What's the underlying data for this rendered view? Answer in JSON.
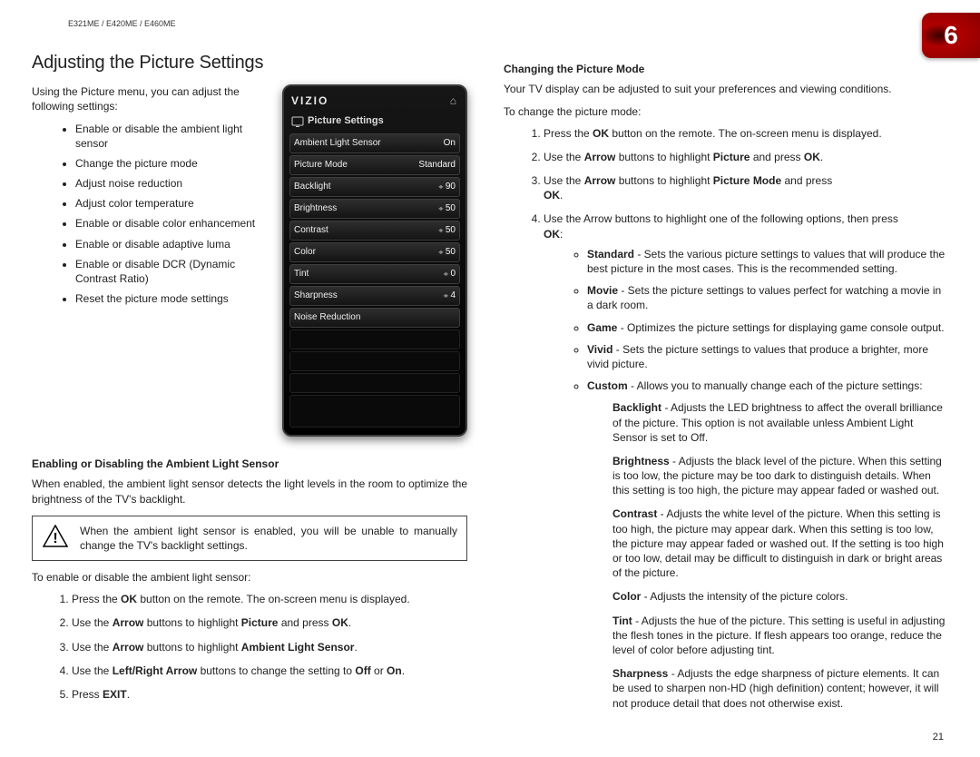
{
  "header": {
    "model": "E321ME / E420ME / E460ME",
    "chapter": "6"
  },
  "page_number": "21",
  "left": {
    "title": "Adjusting the Picture Settings",
    "intro": "Using the Picture menu, you can adjust the following settings:",
    "bullets": [
      "Enable or disable the ambient light sensor",
      "Change the picture mode",
      "Adjust noise reduction",
      "Adjust color temperature",
      "Enable or disable color enhancement",
      "Enable or disable adaptive luma",
      "Enable or disable DCR (Dynamic Contrast Ratio)",
      "Reset the picture mode settings"
    ],
    "subhead1": "Enabling or Disabling the Ambient Light Sensor",
    "als_para": "When enabled, the ambient light sensor detects the light levels in the room to optimize the brightness of the TV's backlight.",
    "warning": "When the ambient light sensor is enabled, you will be unable to manually change the TV's backlight settings.",
    "als_lead": "To enable or disable the ambient light sensor:",
    "steps1": {
      "s1a": "Press the ",
      "s1b": "OK",
      "s1c": " button on the remote. The on-screen menu is displayed.",
      "s2a": "Use the ",
      "s2b": "Arrow",
      "s2c": " buttons to highlight ",
      "s2d": "Picture",
      "s2e": " and press ",
      "s2f": "OK",
      "s2g": ".",
      "s3a": "Use the ",
      "s3b": "Arrow",
      "s3c": " buttons to highlight ",
      "s3d": "Ambient Light Sensor",
      "s3e": ".",
      "s4a": "Use the ",
      "s4b": "Left/Right Arrow",
      "s4c": " buttons to change the setting to ",
      "s4d": "Off",
      "s4e": " or ",
      "s4f": "On",
      "s4g": ".",
      "s5a": "Press ",
      "s5b": "EXIT",
      "s5c": "."
    }
  },
  "right": {
    "subhead": "Changing the Picture Mode",
    "intro": "Your TV display can be adjusted to suit your preferences and viewing conditions.",
    "lead": "To change the picture mode:",
    "steps": {
      "s1a": "Press the ",
      "s1b": "OK",
      "s1c": " button on the remote. The on-screen menu is displayed.",
      "s2a": "Use the ",
      "s2b": "Arrow",
      "s2c": " buttons to highlight ",
      "s2d": "Picture",
      "s2e": " and press ",
      "s2f": "OK",
      "s2g": ".",
      "s3a": "Use the ",
      "s3b": "Arrow",
      "s3c": " buttons to highlight ",
      "s3d": "Picture Mode",
      "s3e": " and press ",
      "s3f": "OK",
      "s3g": ".",
      "s4a": "Use the Arrow buttons to highlight one of the following options, then press ",
      "s4b": "OK",
      "s4c": ":"
    },
    "options": {
      "standard_b": "Standard",
      "standard_t": " - Sets the various picture settings to values that will produce the best picture in the most cases. This is the recommended setting.",
      "movie_b": "Movie",
      "movie_t": " - Sets the picture settings to values perfect for watching a movie in a dark room.",
      "game_b": "Game",
      "game_t": " - Optimizes the picture settings for displaying game console output.",
      "vivid_b": "Vivid",
      "vivid_t": " - Sets the picture settings to values that produce a brighter, more vivid picture.",
      "custom_b": "Custom",
      "custom_t": " - Allows you to manually change each of the picture settings:"
    },
    "custom": {
      "backlight_b": "Backlight",
      "backlight_t": " - Adjusts the LED brightness to affect the overall brilliance of the picture. This option is not available unless Ambient Light Sensor is set to Off.",
      "brightness_b": "Brightness",
      "brightness_t": " - Adjusts the black level of the picture. When this setting is too low, the picture may be too dark to distinguish details. When this setting is too high, the picture may appear faded or washed out.",
      "contrast_b": "Contrast",
      "contrast_t": " - Adjusts the white level of the picture. When this setting is too high, the picture may appear dark. When this setting is too low, the picture may appear faded or washed out. If the setting is too high or too low, detail may be difficult to distinguish in dark or bright areas of the picture.",
      "color_b": "Color",
      "color_t": " - Adjusts the intensity of the picture colors.",
      "tint_b": "Tint",
      "tint_t": " - Adjusts the hue of the picture. This setting is useful in adjusting the flesh tones in the picture. If flesh appears too orange, reduce the level of color before adjusting tint.",
      "sharpness_b": "Sharpness",
      "sharpness_t": " - Adjusts the edge sharpness of picture elements. It can be used to sharpen non-HD (high definition) content; however, it will not produce detail that does not otherwise exist."
    }
  },
  "osd": {
    "brand": "VIZIO",
    "title": "Picture Settings",
    "rows": [
      {
        "label": "Ambient Light Sensor",
        "value": "On",
        "arrows": false
      },
      {
        "label": "Picture Mode",
        "value": "Standard",
        "arrows": false
      },
      {
        "label": "Backlight",
        "value": "90",
        "arrows": true
      },
      {
        "label": "Brightness",
        "value": "50",
        "arrows": true
      },
      {
        "label": "Contrast",
        "value": "50",
        "arrows": true
      },
      {
        "label": "Color",
        "value": "50",
        "arrows": true
      },
      {
        "label": "Tint",
        "value": "0",
        "arrows": true
      },
      {
        "label": "Sharpness",
        "value": "4",
        "arrows": true
      },
      {
        "label": "Noise Reduction",
        "value": "",
        "arrows": false
      }
    ]
  }
}
